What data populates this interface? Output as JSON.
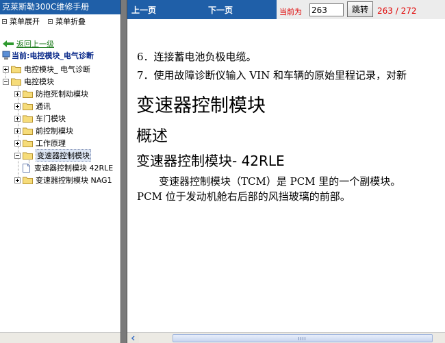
{
  "app": {
    "title": "克莱斯勒300C维修手册"
  },
  "menu": {
    "expand": "菜单展开",
    "collapse": "菜单折叠"
  },
  "nav": {
    "back": "返回上一级",
    "current": "当前:电控模块_电气诊断"
  },
  "tree": [
    {
      "label": "电控模块_ 电气诊断",
      "state": "plus"
    },
    {
      "label": "电控模块",
      "state": "minus"
    },
    {
      "label": "防抱死制动模块",
      "state": "plus"
    },
    {
      "label": "通讯",
      "state": "plus"
    },
    {
      "label": "车门模块",
      "state": "plus"
    },
    {
      "label": "前控制模块",
      "state": "plus"
    },
    {
      "label": "工作原理",
      "state": "plus"
    },
    {
      "label": "变速器控制模块",
      "state": "minus",
      "selected": true
    },
    {
      "label": "变速器控制模块 42RLE",
      "state": "leaf"
    },
    {
      "label": "变速器控制模块 NAG1",
      "state": "plus"
    }
  ],
  "toolbar": {
    "prev": "上一页",
    "next": "下一页",
    "current_label": "当前为",
    "page_value": "263",
    "jump": "跳转",
    "page_count": "263 / 272"
  },
  "content": {
    "line6": "6．连接蓄电池负极电缆。",
    "line7": "7．使用故障诊断仪输入 VIN 和车辆的原始里程记录，对新",
    "heading1": "变速器控制模块",
    "heading2": "概述",
    "heading3": "变速器控制模块- 42RLE",
    "paragraph": "变速器控制模块（TCM）是 PCM 里的一个副模块。PCM 位于发动机舱右后部的风挡玻璃的前部。"
  },
  "colors": {
    "title_bar": "#1f5fa8",
    "page_text": "#e00000",
    "current_text": "#0a2a8a",
    "back_link": "#1a7a1a"
  }
}
